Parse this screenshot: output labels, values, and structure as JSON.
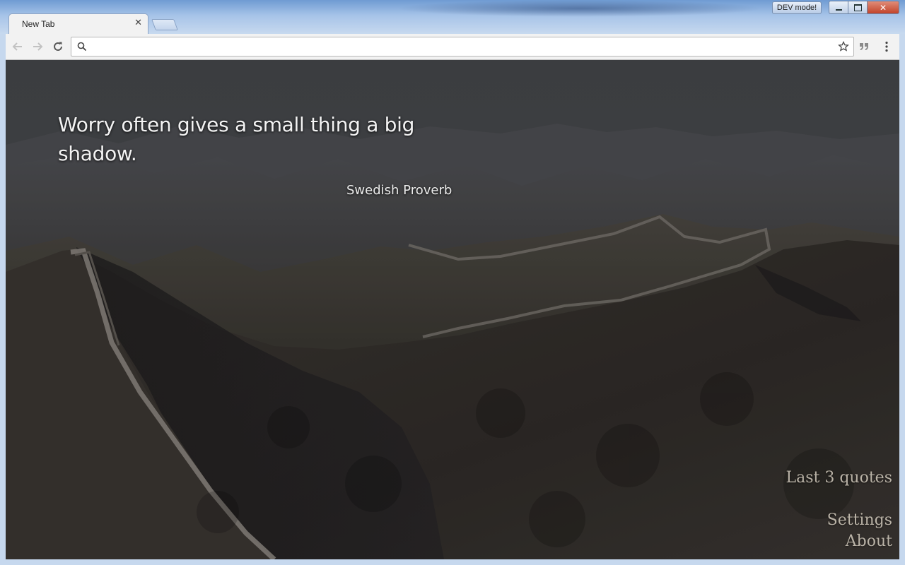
{
  "window": {
    "profile_badge": "DEV mode!",
    "controls": {
      "minimize": "minimize",
      "maximize": "maximize",
      "close": "close"
    }
  },
  "tabs": [
    {
      "title": "New Tab",
      "active": true
    }
  ],
  "toolbar": {
    "back_icon": "arrow-left-icon",
    "forward_icon": "arrow-right-icon",
    "reload_icon": "reload-icon",
    "omnibox": {
      "value": "",
      "placeholder": ""
    },
    "bookmark_icon": "star-icon",
    "extension_icon": "quote-extension-icon",
    "menu_icon": "kebab-menu-icon"
  },
  "page": {
    "quote_text": "Worry often gives a small thing a big shadow.",
    "quote_author": "Swedish Proverb",
    "links": {
      "last_quotes": "Last 3 quotes",
      "settings": "Settings",
      "about": "About"
    }
  },
  "colors": {
    "title_bar": "#a9c4e6",
    "toolbar": "#f2f2f2",
    "overlay_text": "#f3f3f3",
    "link_text": "#b9b2a6"
  }
}
